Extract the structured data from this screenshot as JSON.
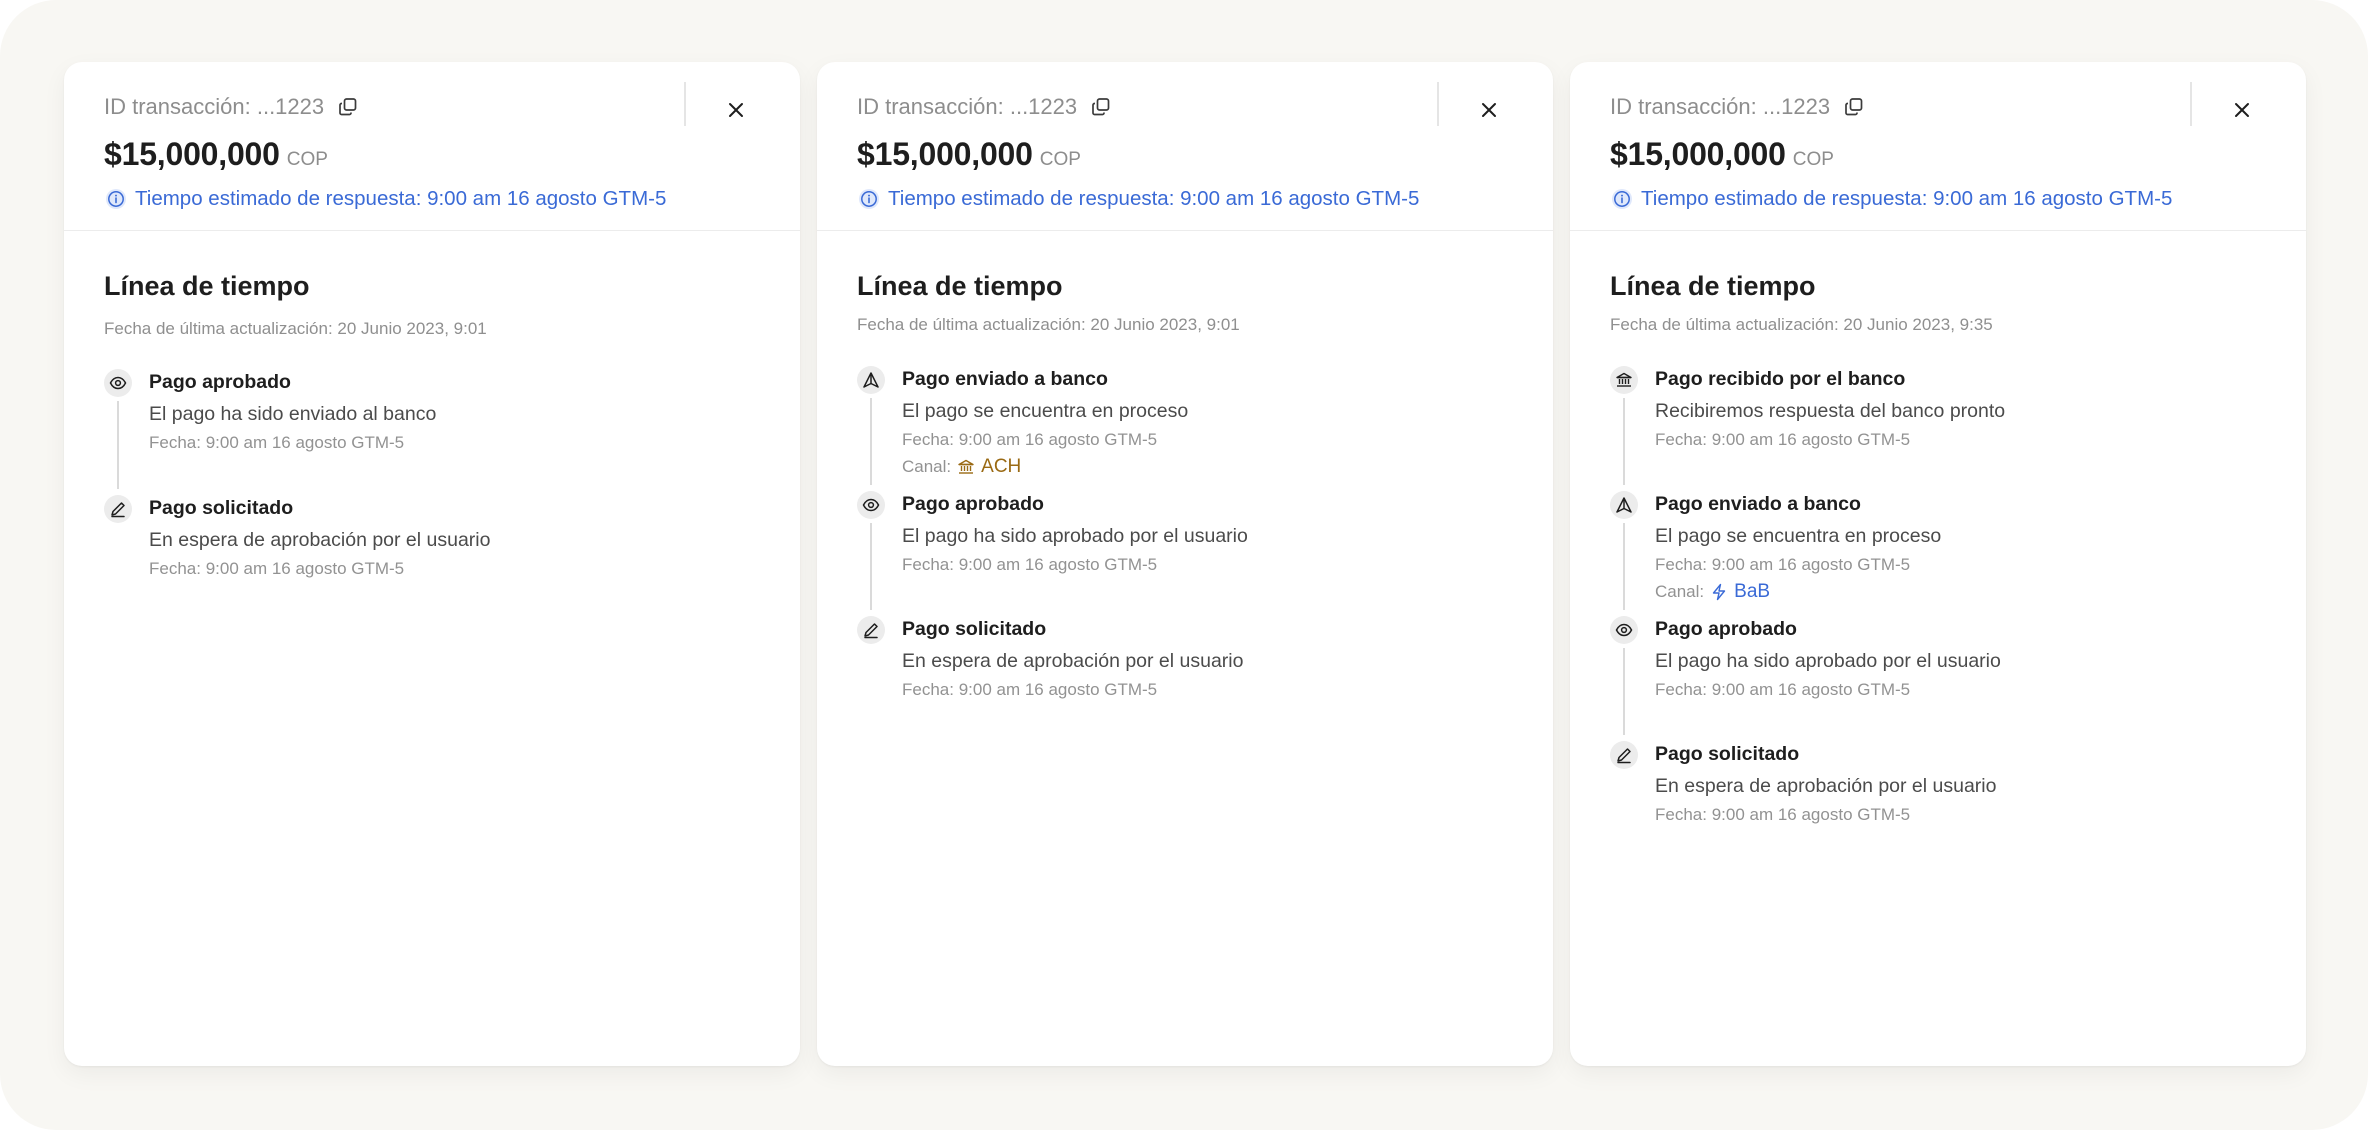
{
  "colors": {
    "background": "#f8f7f3",
    "accent_blue": "#3a6ad6",
    "ach_gold": "#9a6a14",
    "bab_blue": "#3a6ad6"
  },
  "panels": [
    {
      "txid_label": "ID transacción: ...1223",
      "amount": "$15,000,000",
      "currency": "COP",
      "eta": "Tiempo estimado de respuesta: 9:00 am 16 agosto GTM-5",
      "timeline_title": "Línea de tiempo",
      "updated": "Fecha de última actualización: 20 Junio 2023, 9:01",
      "events": [
        {
          "icon": "eye-icon",
          "title": "Pago aprobado",
          "desc": "El pago ha sido enviado al banco",
          "date": "Fecha: 9:00 am 16 agosto GTM-5"
        },
        {
          "icon": "pen-icon",
          "title": "Pago solicitado",
          "desc": "En espera de aprobación por el usuario",
          "date": "Fecha: 9:00 am 16 agosto GTM-5"
        }
      ]
    },
    {
      "txid_label": "ID transacción: ...1223",
      "amount": "$15,000,000",
      "currency": "COP",
      "eta": "Tiempo estimado de respuesta: 9:00 am 16 agosto GTM-5",
      "timeline_title": "Línea de tiempo",
      "updated": "Fecha de última actualización: 20 Junio 2023, 9:01",
      "events": [
        {
          "icon": "send-icon",
          "title": "Pago enviado a banco",
          "desc": "El pago se encuentra en proceso",
          "date": "Fecha: 9:00 am 16 agosto GTM-5",
          "channel_label": "Canal:",
          "channel_value": "ACH",
          "channel_icon": "bank-icon"
        },
        {
          "icon": "eye-icon",
          "title": "Pago aprobado",
          "desc": "El pago ha sido aprobado por el usuario",
          "date": "Fecha: 9:00 am 16 agosto GTM-5"
        },
        {
          "icon": "pen-icon",
          "title": "Pago solicitado",
          "desc": "En espera de aprobación por el usuario",
          "date": "Fecha: 9:00 am 16 agosto GTM-5"
        }
      ]
    },
    {
      "txid_label": "ID transacción: ...1223",
      "amount": "$15,000,000",
      "currency": "COP",
      "eta": "Tiempo estimado de respuesta: 9:00 am 16 agosto GTM-5",
      "timeline_title": "Línea de tiempo",
      "updated": "Fecha de última actualización: 20 Junio 2023, 9:35",
      "events": [
        {
          "icon": "bank-icon",
          "title": "Pago recibido por el banco",
          "desc": "Recibiremos respuesta del banco pronto",
          "date": "Fecha: 9:00 am 16 agosto GTM-5"
        },
        {
          "icon": "send-icon",
          "title": "Pago enviado a banco",
          "desc": "El pago se encuentra en proceso",
          "date": "Fecha: 9:00 am 16 agosto GTM-5",
          "channel_label": "Canal:",
          "channel_value": "BaB",
          "channel_icon": "lightning-icon"
        },
        {
          "icon": "eye-icon",
          "title": "Pago aprobado",
          "desc": "El pago ha sido aprobado por el usuario",
          "date": "Fecha: 9:00 am 16 agosto GTM-5"
        },
        {
          "icon": "pen-icon",
          "title": "Pago solicitado",
          "desc": "En espera de aprobación por el usuario",
          "date": "Fecha: 9:00 am 16 agosto GTM-5"
        }
      ]
    }
  ]
}
